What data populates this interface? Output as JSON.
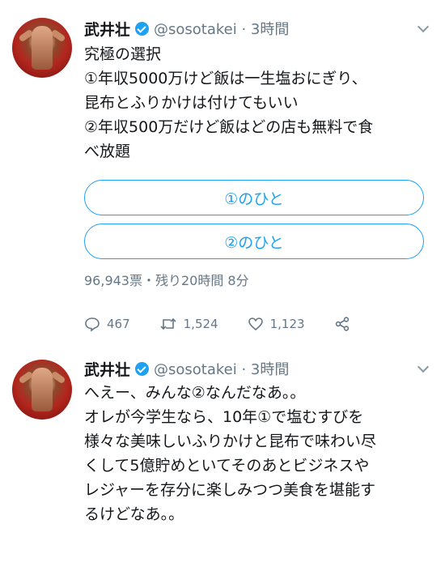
{
  "tweet1": {
    "name": "武井壮",
    "handle": "@sosotakei · 3時間",
    "text": "究極の選択\n①年収5000万けど飯は一生塩おにぎり、\n昆布とふりかけは付けてもいい\n②年収500万だけど飯はどの店も無料で食\nべ放題",
    "poll": {
      "options": [
        "①のひと",
        "②のひと"
      ],
      "meta": "96,943票・残り20時間 8分"
    },
    "actions": {
      "replies": "467",
      "retweets": "1,524",
      "likes": "1,123"
    }
  },
  "tweet2": {
    "name": "武井壮",
    "handle": "@sosotakei · 3時間",
    "text": "へえー、みんな②なんだなあ。。\nオレが今学生なら、10年①で塩むすびを\n様々な美味しいふりかけと昆布で味わい尽\nくして5億貯めといてそのあとビジネスや\nレジャーを存分に楽しみつつ美食を堪能す\nるけどなあ。。"
  },
  "colors": {
    "accent": "#1da1f2",
    "muted": "#657786",
    "text": "#14171a"
  }
}
